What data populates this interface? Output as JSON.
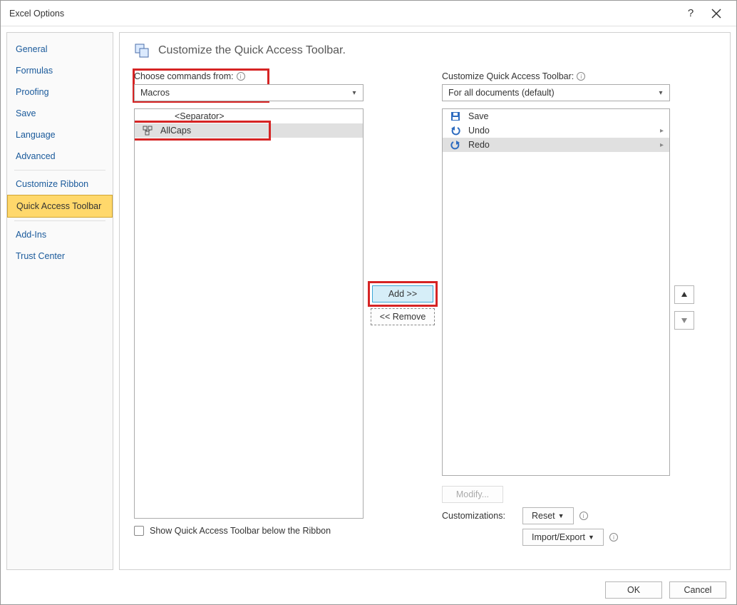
{
  "window": {
    "title": "Excel Options"
  },
  "sidebar": {
    "items": [
      {
        "label": "General"
      },
      {
        "label": "Formulas"
      },
      {
        "label": "Proofing"
      },
      {
        "label": "Save"
      },
      {
        "label": "Language"
      },
      {
        "label": "Advanced"
      },
      {
        "label": "Customize Ribbon"
      },
      {
        "label": "Quick Access Toolbar"
      },
      {
        "label": "Add-Ins"
      },
      {
        "label": "Trust Center"
      }
    ],
    "selected_index": 7
  },
  "header": {
    "title": "Customize the Quick Access Toolbar."
  },
  "left_column": {
    "label": "Choose commands from:",
    "dropdown_value": "Macros",
    "list": [
      {
        "label": "<Separator>",
        "icon": "separator"
      },
      {
        "label": "AllCaps",
        "icon": "macro",
        "selected": true
      }
    ]
  },
  "right_column": {
    "label": "Customize Quick Access Toolbar:",
    "dropdown_value": "For all documents (default)",
    "list": [
      {
        "label": "Save",
        "icon": "save"
      },
      {
        "label": "Undo",
        "icon": "undo",
        "submenu": true
      },
      {
        "label": "Redo",
        "icon": "redo",
        "submenu": true,
        "selected": true
      }
    ]
  },
  "center": {
    "add_label": "Add >>",
    "remove_label": "<< Remove"
  },
  "below_right": {
    "modify_label": "Modify...",
    "customizations_label": "Customizations:",
    "reset_label": "Reset",
    "import_export_label": "Import/Export"
  },
  "below_left": {
    "checkbox_label": "Show Quick Access Toolbar below the Ribbon"
  },
  "footer": {
    "ok_label": "OK",
    "cancel_label": "Cancel"
  }
}
